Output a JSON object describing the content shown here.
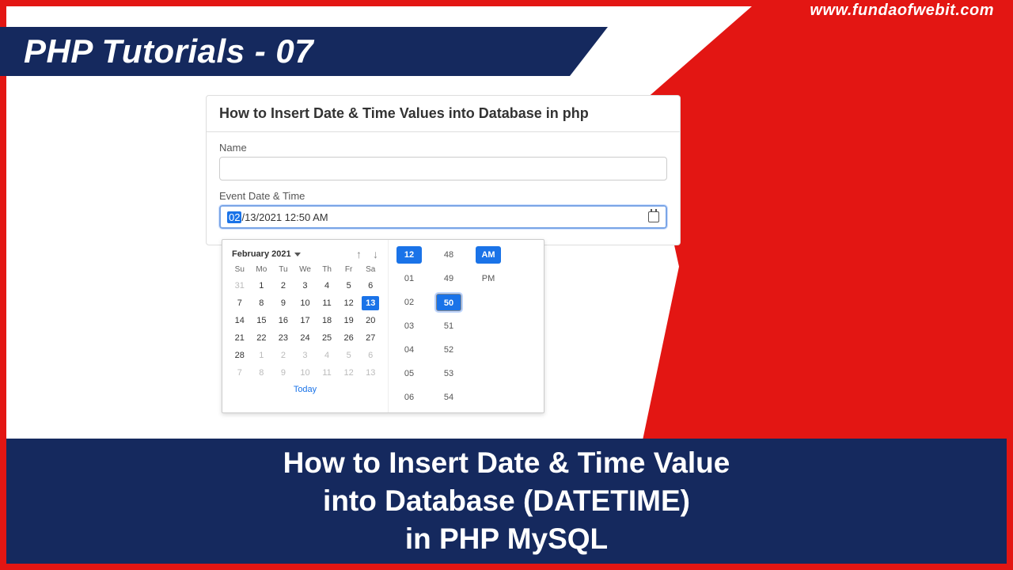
{
  "branding": {
    "url": "www.fundaofwebit.com"
  },
  "header": {
    "title": "PHP Tutorials - 07"
  },
  "bottom": {
    "line1": "How to Insert Date & Time Value",
    "line2": "into Database (DATETIME)",
    "line3": "in PHP MySQL"
  },
  "card": {
    "title": "How to Insert Date & Time Values into Database in php",
    "name_label": "Name",
    "name_value": "",
    "dt_label": "Event Date & Time",
    "dt_selected_month": "02",
    "dt_rest": "/13/2021 12:50 AM"
  },
  "calendar": {
    "month_label": "February 2021",
    "today_label": "Today",
    "dow": [
      "Su",
      "Mo",
      "Tu",
      "We",
      "Th",
      "Fr",
      "Sa"
    ],
    "weeks": [
      [
        {
          "d": "31",
          "muted": true
        },
        {
          "d": "1"
        },
        {
          "d": "2"
        },
        {
          "d": "3"
        },
        {
          "d": "4"
        },
        {
          "d": "5"
        },
        {
          "d": "6"
        }
      ],
      [
        {
          "d": "7"
        },
        {
          "d": "8"
        },
        {
          "d": "9"
        },
        {
          "d": "10"
        },
        {
          "d": "11"
        },
        {
          "d": "12"
        },
        {
          "d": "13",
          "sel": true
        }
      ],
      [
        {
          "d": "14"
        },
        {
          "d": "15"
        },
        {
          "d": "16"
        },
        {
          "d": "17"
        },
        {
          "d": "18"
        },
        {
          "d": "19"
        },
        {
          "d": "20"
        }
      ],
      [
        {
          "d": "21"
        },
        {
          "d": "22"
        },
        {
          "d": "23"
        },
        {
          "d": "24"
        },
        {
          "d": "25"
        },
        {
          "d": "26"
        },
        {
          "d": "27"
        }
      ],
      [
        {
          "d": "28"
        },
        {
          "d": "1",
          "muted": true
        },
        {
          "d": "2",
          "muted": true
        },
        {
          "d": "3",
          "muted": true
        },
        {
          "d": "4",
          "muted": true
        },
        {
          "d": "5",
          "muted": true
        },
        {
          "d": "6",
          "muted": true
        }
      ],
      [
        {
          "d": "7",
          "muted": true
        },
        {
          "d": "8",
          "muted": true
        },
        {
          "d": "9",
          "muted": true
        },
        {
          "d": "10",
          "muted": true
        },
        {
          "d": "11",
          "muted": true
        },
        {
          "d": "12",
          "muted": true
        },
        {
          "d": "13",
          "muted": true
        }
      ]
    ]
  },
  "time": {
    "hours": [
      {
        "v": "12",
        "sel": true
      },
      {
        "v": "01"
      },
      {
        "v": "02"
      },
      {
        "v": "03"
      },
      {
        "v": "04"
      },
      {
        "v": "05"
      },
      {
        "v": "06"
      }
    ],
    "minutes": [
      {
        "v": "48"
      },
      {
        "v": "49"
      },
      {
        "v": "50",
        "sel": true,
        "box": true
      },
      {
        "v": "51"
      },
      {
        "v": "52"
      },
      {
        "v": "53"
      },
      {
        "v": "54"
      }
    ],
    "ampm": [
      {
        "v": "AM",
        "sel": true
      },
      {
        "v": "PM"
      }
    ]
  }
}
